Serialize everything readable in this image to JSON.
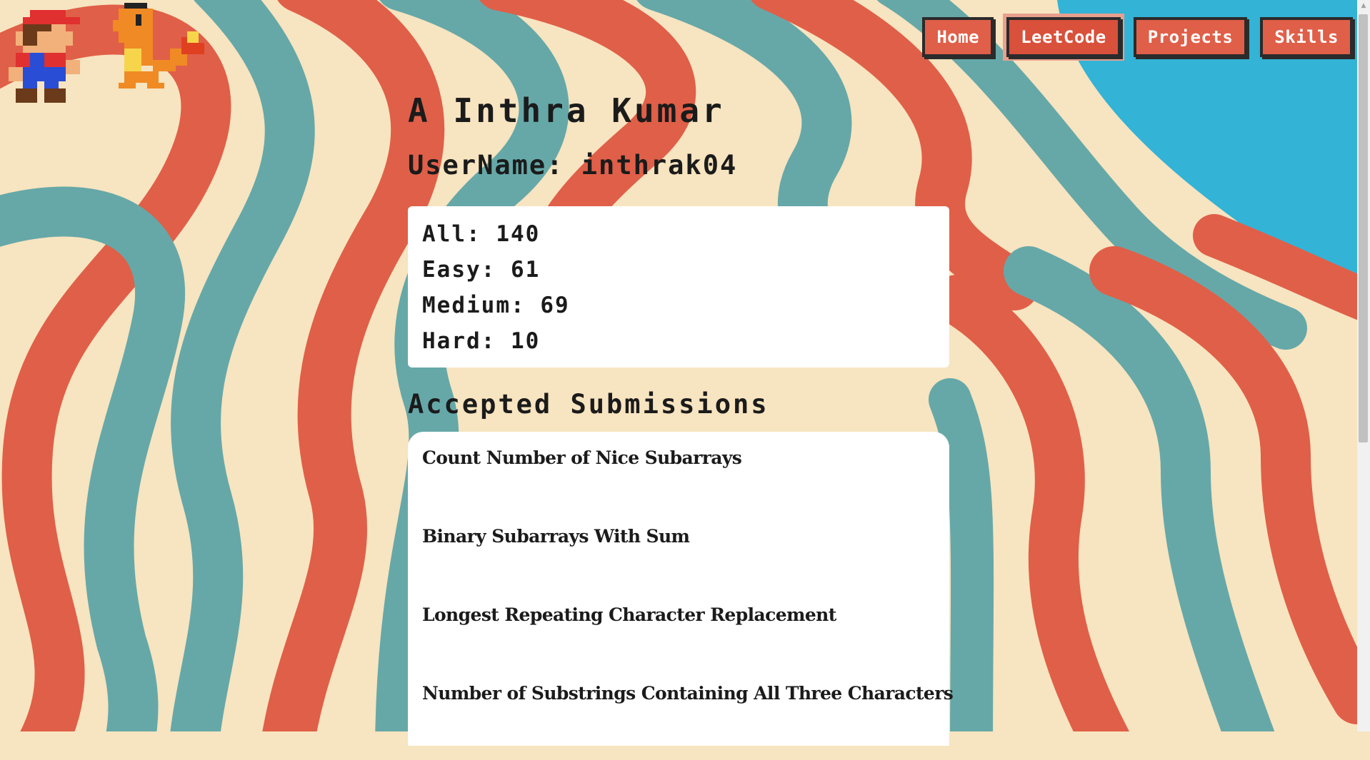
{
  "nav": {
    "items": [
      {
        "label": "Home"
      },
      {
        "label": "LeetCode"
      },
      {
        "label": "Projects"
      },
      {
        "label": "Skills"
      }
    ]
  },
  "profile": {
    "name": "A Inthra Kumar",
    "username_label": "UserName:",
    "username": "inthrak04"
  },
  "stats": [
    {
      "label": "All:",
      "value": "140"
    },
    {
      "label": "Easy:",
      "value": "61"
    },
    {
      "label": "Medium:",
      "value": "69"
    },
    {
      "label": "Hard:",
      "value": "10"
    }
  ],
  "submissions": {
    "title": "Accepted Submissions",
    "items": [
      "Count Number of Nice Subarrays",
      "Binary Subarrays With Sum",
      "Longest Repeating Character Replacement",
      "Number of Substrings Containing All Three Characters"
    ]
  },
  "colors": {
    "cream": "#f7e4c0",
    "red": "#e05f48",
    "teal": "#66a8a8",
    "blue": "#33b3d6",
    "ink": "#1b1b1b"
  },
  "icons": [
    "mario-sprite",
    "charmander-sprite"
  ]
}
